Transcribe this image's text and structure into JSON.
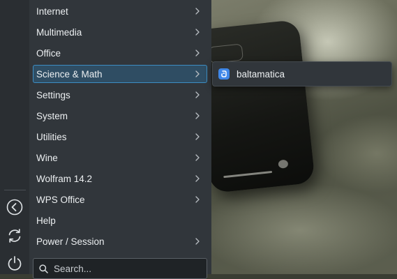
{
  "menu": {
    "items": [
      {
        "label": "Internet",
        "has_submenu": true
      },
      {
        "label": "Multimedia",
        "has_submenu": true
      },
      {
        "label": "Office",
        "has_submenu": true
      },
      {
        "label": "Science & Math",
        "has_submenu": true,
        "active": true
      },
      {
        "label": "Settings",
        "has_submenu": true
      },
      {
        "label": "System",
        "has_submenu": true
      },
      {
        "label": "Utilities",
        "has_submenu": true
      },
      {
        "label": "Wine",
        "has_submenu": true
      },
      {
        "label": "Wolfram 14.2",
        "has_submenu": true
      },
      {
        "label": "WPS Office",
        "has_submenu": true
      },
      {
        "label": "Help",
        "has_submenu": false
      },
      {
        "label": "Power / Session",
        "has_submenu": true
      }
    ]
  },
  "search": {
    "placeholder": "Search..."
  },
  "submenu": {
    "items": [
      {
        "label": "baltamatica",
        "icon": "baltamatica-app-icon"
      }
    ]
  },
  "rail": {
    "buttons": [
      "back-icon",
      "refresh-icon",
      "power-icon"
    ]
  },
  "colors": {
    "accent": "#3d8ec4",
    "active_bg": "#2f4d63",
    "panel_bg": "#31363b",
    "rail_bg": "#2a2e32",
    "text": "#eceff1"
  }
}
